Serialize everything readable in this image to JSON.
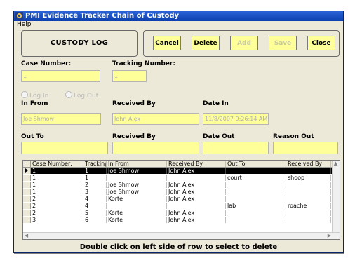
{
  "window": {
    "title": "PMI Evidence Tracker Chain of Custody",
    "app_icon": "pmi-app-icon"
  },
  "menu": {
    "help": "Help"
  },
  "header": {
    "log_title": "CUSTODY LOG"
  },
  "toolbar": {
    "cancel": "Cancel",
    "delete": "Delete",
    "add": "Add",
    "save": "Save",
    "close": "Close"
  },
  "form": {
    "case_number_label": "Case Number:",
    "case_number_value": "1",
    "tracking_number_label": "Tracking Number:",
    "tracking_number_value": "1",
    "log_in_label": "Log In",
    "log_out_label": "Log Out",
    "in_from_label": "In From",
    "in_from_value": "Joe Shmow",
    "received_by_in_label": "Received By",
    "received_by_in_value": "John Alex",
    "date_in_label": "Date In",
    "date_in_value": "11/8/2007 9:26:14 AM",
    "out_to_label": "Out To",
    "out_to_value": "",
    "received_by_out_label": "Received By",
    "received_by_out_value": "",
    "date_out_label": "Date Out",
    "date_out_value": "",
    "reason_out_label": "Reason Out",
    "reason_out_value": ""
  },
  "grid": {
    "columns": [
      "Case Number:",
      "Tracking",
      "In From",
      "Received By",
      "Out To",
      "Received By"
    ],
    "rows": [
      [
        "1",
        "1",
        "Joe Shmow",
        "John Alex",
        "",
        ""
      ],
      [
        "1",
        "1",
        "",
        "",
        "court",
        "shoop"
      ],
      [
        "1",
        "2",
        "Joe Shmow",
        "John Alex",
        "",
        ""
      ],
      [
        "1",
        "3",
        "Joe Shmow",
        "John Alex",
        "",
        ""
      ],
      [
        "2",
        "4",
        "Korte",
        "John Alex",
        "",
        ""
      ],
      [
        "2",
        "4",
        "",
        "",
        "lab",
        "roache"
      ],
      [
        "2",
        "5",
        "Korte",
        "John Alex",
        "",
        ""
      ],
      [
        "3",
        "6",
        "Korte",
        "John Alex",
        "",
        ""
      ]
    ]
  },
  "footer": {
    "hint": "Double click on left side of row to select to delete"
  }
}
